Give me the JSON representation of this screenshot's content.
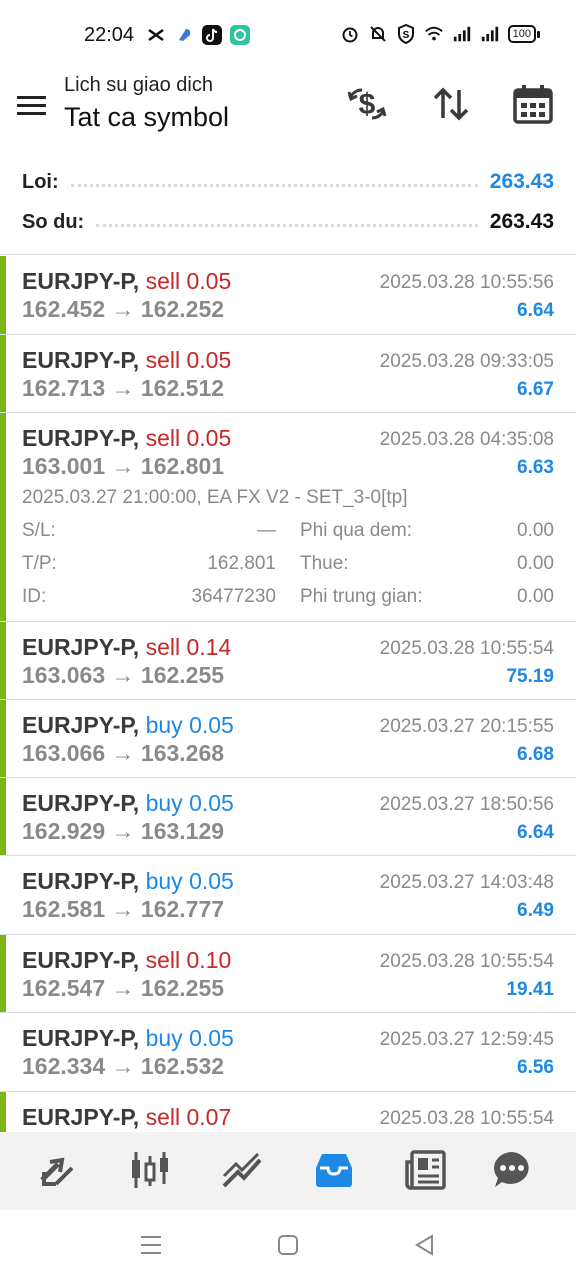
{
  "status": {
    "time": "22:04",
    "battery": "100"
  },
  "header": {
    "subtitle": "Lich su giao dich",
    "title": "Tat ca symbol"
  },
  "summary": {
    "profit_label": "Loi:",
    "profit_value": "263.43",
    "balance_label": "So du:",
    "balance_value": "263.43"
  },
  "colors": {
    "accent_green": "#7cb518",
    "sell_red": "#c62828",
    "buy_blue": "#1e88e5",
    "profit_blue": "#1e88e5"
  },
  "trades": [
    {
      "symbol": "EURJPY-P,",
      "type": "sell 0.05",
      "date": "2025.03.28 10:55:56",
      "prices": "162.452 → 162.252",
      "profit": "6.64"
    },
    {
      "symbol": "EURJPY-P,",
      "type": "sell 0.05",
      "date": "2025.03.28 09:33:05",
      "prices": "162.713 → 162.512",
      "profit": "6.67"
    },
    {
      "symbol": "EURJPY-P,",
      "type": "sell 0.05",
      "date": "2025.03.28 04:35:08",
      "prices": "163.001 → 162.801",
      "profit": "6.63",
      "details": {
        "comment": "2025.03.27 21:00:00, EA FX V2 - SET_3-0[tp]",
        "sl_label": "S/L:",
        "sl_value": "—",
        "tp_label": "T/P:",
        "tp_value": "162.801",
        "id_label": "ID:",
        "id_value": "36477230",
        "swap_label": "Phi qua dem:",
        "swap_value": "0.00",
        "tax_label": "Thue:",
        "tax_value": "0.00",
        "commission_label": "Phi trung gian:",
        "commission_value": "0.00"
      }
    },
    {
      "symbol": "EURJPY-P,",
      "type": "sell 0.14",
      "date": "2025.03.28 10:55:54",
      "prices": "163.063 → 162.255",
      "profit": "75.19"
    },
    {
      "symbol": "EURJPY-P,",
      "type": "buy 0.05",
      "date": "2025.03.27 20:15:55",
      "prices": "163.066 → 163.268",
      "profit": "6.68"
    },
    {
      "symbol": "EURJPY-P,",
      "type": "buy 0.05",
      "date": "2025.03.27 18:50:56",
      "prices": "162.929 → 163.129",
      "profit": "6.64"
    },
    {
      "symbol": "EURJPY-P,",
      "type": "buy 0.05",
      "date": "2025.03.27 14:03:48",
      "prices": "162.581 → 162.777",
      "profit": "6.49"
    },
    {
      "symbol": "EURJPY-P,",
      "type": "sell 0.10",
      "date": "2025.03.28 10:55:54",
      "prices": "162.547 → 162.255",
      "profit": "19.41"
    },
    {
      "symbol": "EURJPY-P,",
      "type": "buy 0.05",
      "date": "2025.03.27 12:59:45",
      "prices": "162.334 → 162.532",
      "profit": "6.56"
    },
    {
      "symbol": "EURJPY-P,",
      "type": "sell 0.07",
      "date": "2025.03.28 10:55:54",
      "prices": "",
      "profit": ""
    }
  ],
  "nav": {
    "items": [
      "trade-icon",
      "chart-icon",
      "indicator-icon",
      "history-icon",
      "news-icon",
      "chat-icon"
    ],
    "active": "history-icon"
  }
}
